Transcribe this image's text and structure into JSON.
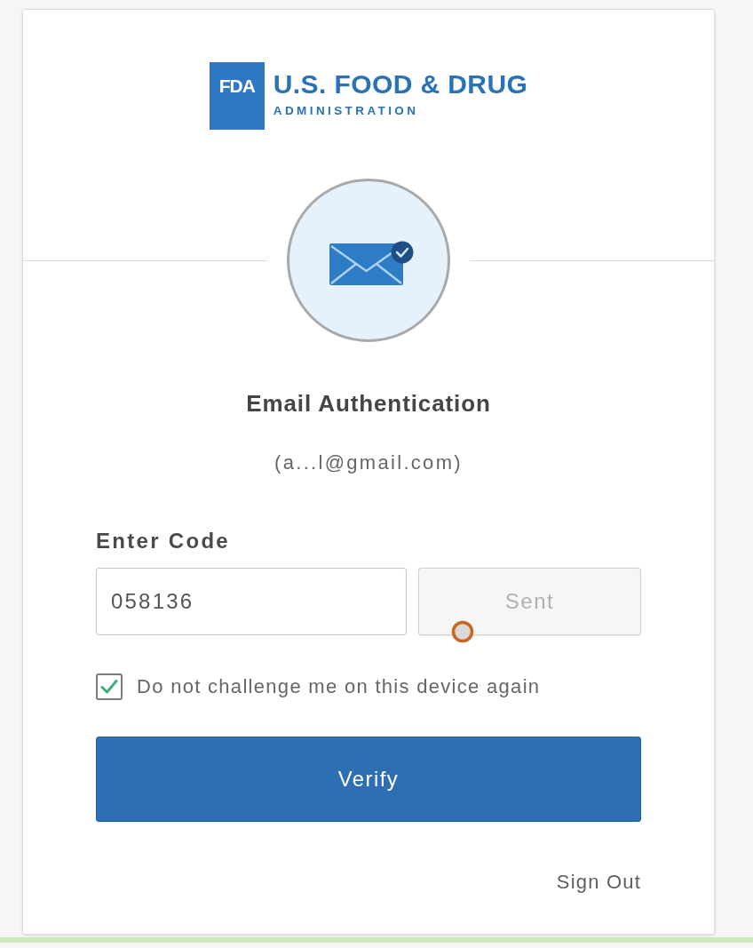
{
  "logo": {
    "badge": "FDA",
    "title": "U.S. FOOD & DRUG",
    "subtitle": "ADMINISTRATION"
  },
  "heading": "Email Authentication",
  "email": "(a...l@gmail.com)",
  "code_field": {
    "label": "Enter Code",
    "value": "058136"
  },
  "send_button": {
    "label": "Sent",
    "disabled": true
  },
  "remember_checkbox": {
    "label": "Do not challenge me on this device again",
    "checked": true
  },
  "verify_button": {
    "label": "Verify"
  },
  "sign_out_link": {
    "label": "Sign Out"
  }
}
